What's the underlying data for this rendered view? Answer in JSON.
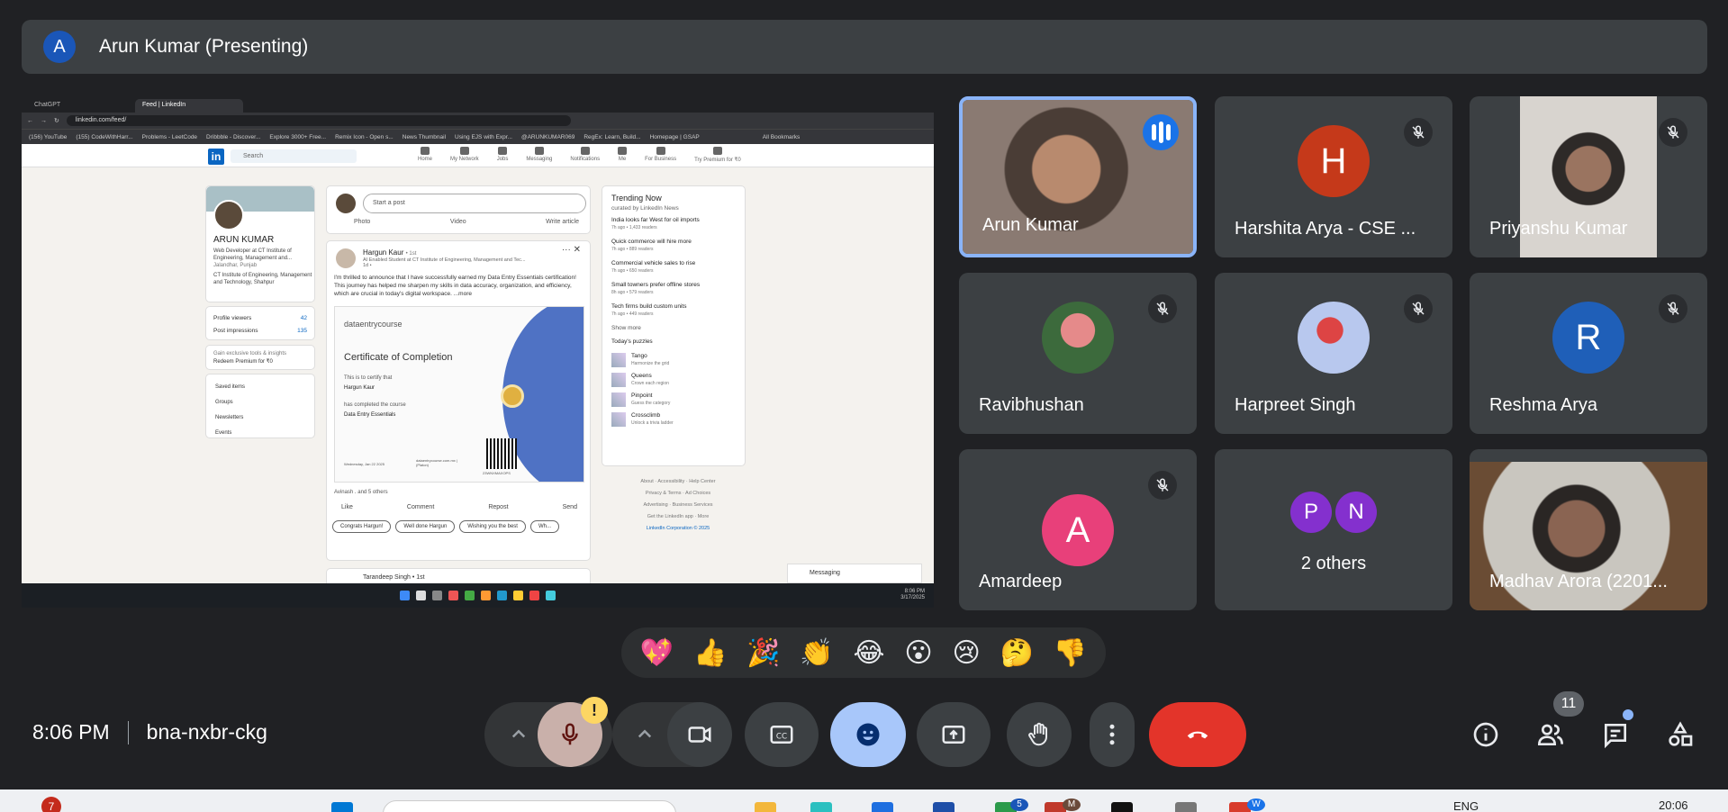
{
  "presenter": {
    "initial": "A",
    "label": "Arun Kumar (Presenting)"
  },
  "shared_screen": {
    "tabs": [
      "ChatGPT",
      "Feed | LinkedIn"
    ],
    "url": "linkedin.com/feed/",
    "bookmarks": [
      "(156) YouTube",
      "(155) CodeWithHarr...",
      "Problems - LeetCode",
      "Dribbble - Discover...",
      "Explore 3000+ Free...",
      "Remix Icon - Open s...",
      "News Thumbnail",
      "Using EJS with Expr...",
      "@ARUNKUMAR069",
      "RegEx: Learn, Build...",
      "Homepage | GSAP",
      "All Bookmarks"
    ],
    "nav": {
      "search": "Search",
      "items": [
        "Home",
        "My Network",
        "Jobs",
        "Messaging",
        "Notifications",
        "Me",
        "For Business",
        "Try Premium for ₹0"
      ]
    },
    "profile": {
      "name": "ARUN KUMAR",
      "headline": "Web Developer at CT Institute of Engineering, Management and...",
      "location": "Jalandhar, Punjab",
      "org": "CT Institute of Engineering, Management and Technology, Shahpur",
      "profile_viewers_label": "Profile viewers",
      "profile_viewers": "42",
      "impressions_label": "Post impressions",
      "impressions": "135",
      "premium_text": "Gain exclusive tools & insights",
      "premium_link": "Redeem Premium for ₹0",
      "links": [
        "Saved items",
        "Groups",
        "Newsletters",
        "Events"
      ]
    },
    "start_post": {
      "placeholder": "Start a post",
      "actions": [
        "Photo",
        "Video",
        "Write article"
      ]
    },
    "post": {
      "author": "Hargun Kaur",
      "degree": "• 1st",
      "subtitle": "AI Enabled Student at CT Institute of Engineering, Management and Tec...",
      "time": "1d •",
      "text": "I'm thrilled to announce that I have successfully earned my Data Entry Essentials certification! This journey has helped me sharpen my skills in data accuracy, organization, and efficiency, which are crucial in today's digital workspace. ...more",
      "certificate": {
        "brand": "dataentrycourse",
        "title": "Certificate of Completion",
        "line1": "This is to certify that",
        "recipient": "Hargun Kaur",
        "line2": "has completed the course",
        "course": "Data Entry Essentials",
        "date": "Wednesday, Jan 22 2025",
        "site": "dataentrycourse.com.mx | (Platon)",
        "code": "23WNXMAXOPS"
      },
      "reactions": "Avinash . and 5 others",
      "actions": [
        "Like",
        "Comment",
        "Repost",
        "Send"
      ],
      "chips": [
        "Congrats Hargun!",
        "Well done Hargun",
        "Wishing you the best",
        "Wh..."
      ]
    },
    "next_post_author": "Tarandeep Singh • 1st",
    "trending": {
      "title": "Trending Now",
      "curated": "curated by LinkedIn News",
      "items": [
        {
          "headline": "India looks far West for oil imports",
          "meta": "7h ago • 1,433 readers"
        },
        {
          "headline": "Quick commerce will hire more",
          "meta": "7h ago • 889 readers"
        },
        {
          "headline": "Commercial vehicle sales to rise",
          "meta": "7h ago • 650 readers"
        },
        {
          "headline": "Small towners prefer offline stores",
          "meta": "8h ago • 579 readers"
        },
        {
          "headline": "Tech firms build custom units",
          "meta": "7h ago • 449 readers"
        }
      ],
      "show_more": "Show more",
      "puzzles_title": "Today's puzzles",
      "puzzles": [
        {
          "name": "Tango",
          "desc": "Harmonize the grid"
        },
        {
          "name": "Queens",
          "desc": "Crown each region"
        },
        {
          "name": "Pinpoint",
          "desc": "Guess the category"
        },
        {
          "name": "Crossclimb",
          "desc": "Unlock a trivia ladder"
        }
      ]
    },
    "footer": [
      "About",
      "Accessibility",
      "Help Center",
      "Privacy & Terms",
      "Ad Choices",
      "Advertising",
      "Business Services",
      "Get the LinkedIn app",
      "More",
      "LinkedIn Corporation © 2025"
    ],
    "messaging": "Messaging",
    "clock": {
      "time": "8:06 PM",
      "date": "3/17/2025"
    }
  },
  "participants": [
    {
      "name": "Arun Kumar",
      "type": "video",
      "speaking": true
    },
    {
      "name": "Harshita Arya - CSE ...",
      "type": "avatar",
      "initial": "H",
      "color": "#c5391a",
      "muted": true
    },
    {
      "name": "Priyanshu Kumar",
      "type": "video",
      "muted": true
    },
    {
      "name": "Ravibhushan",
      "type": "photo",
      "muted": true
    },
    {
      "name": "Harpreet Singh",
      "type": "photo",
      "muted": true
    },
    {
      "name": "Reshma Arya",
      "type": "avatar",
      "initial": "R",
      "color": "#1f5fb8",
      "muted": true
    },
    {
      "name": "Amardeep",
      "type": "avatar",
      "initial": "A",
      "color": "#e8407a",
      "muted": true
    },
    {
      "name": "2 others",
      "type": "others",
      "initials": [
        "P",
        "N"
      ]
    },
    {
      "name": "Madhav Arora (2201...",
      "type": "video"
    }
  ],
  "reactions": [
    "💖",
    "👍",
    "🎉",
    "👏",
    "😂",
    "😮",
    "😢",
    "🤔",
    "👎"
  ],
  "meeting": {
    "time": "8:06 PM",
    "code": "bna-nxbr-ckg",
    "people_count": "11",
    "warn": "!"
  },
  "os_taskbar": {
    "notif": "7",
    "lang": "ENG",
    "time": "20:06",
    "badge1": "5",
    "badge2": "M",
    "badge3": "W"
  },
  "colors": {
    "bg": "#202124",
    "tile": "#3c4043",
    "accent": "#8ab4f8",
    "end_call": "#e3342a",
    "emoji_active": "#a8c7fa"
  }
}
